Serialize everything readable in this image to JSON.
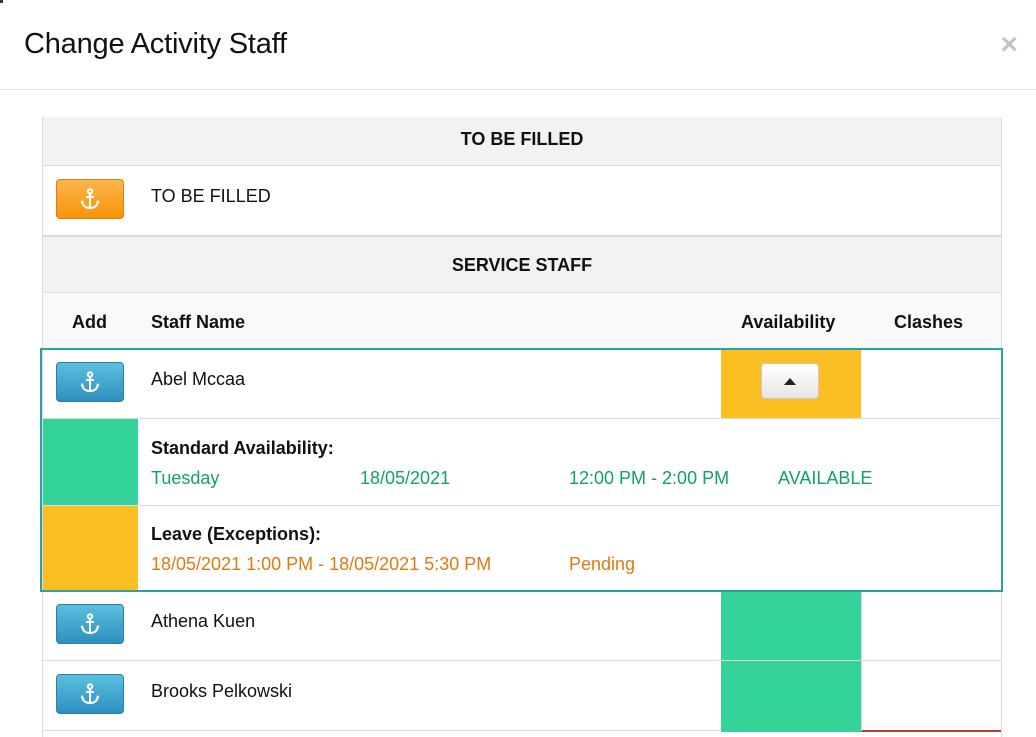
{
  "modal": {
    "title": "Change Activity Staff",
    "close_glyph": "×"
  },
  "colors": {
    "available": "#34d399",
    "leave": "#fbbf24",
    "accent_border": "#2aa1a8"
  },
  "to_be_filled_section": {
    "header": "TO BE FILLED",
    "row_label": "TO BE FILLED",
    "add_icon": "anchor-icon"
  },
  "service_staff_section": {
    "header": "SERVICE STAFF",
    "columns": {
      "add": "Add",
      "staff_name": "Staff Name",
      "availability": "Availability",
      "clashes": "Clashes"
    },
    "staff": [
      {
        "name": "Abel Mccaa",
        "availability_status": "leave",
        "expanded": true,
        "details": {
          "standard_label": "Standard Availability:",
          "standard_day": "Tuesday",
          "standard_date": "18/05/2021",
          "standard_time": "12:00 PM - 2:00 PM",
          "standard_status": "AVAILABLE",
          "leave_label": "Leave (Exceptions):",
          "leave_range": "18/05/2021 1:00 PM - 18/05/2021 5:30 PM",
          "leave_status": "Pending"
        }
      },
      {
        "name": "Athena Kuen",
        "availability_status": "available"
      },
      {
        "name": "Brooks Pelkowski",
        "availability_status": "available"
      }
    ]
  }
}
